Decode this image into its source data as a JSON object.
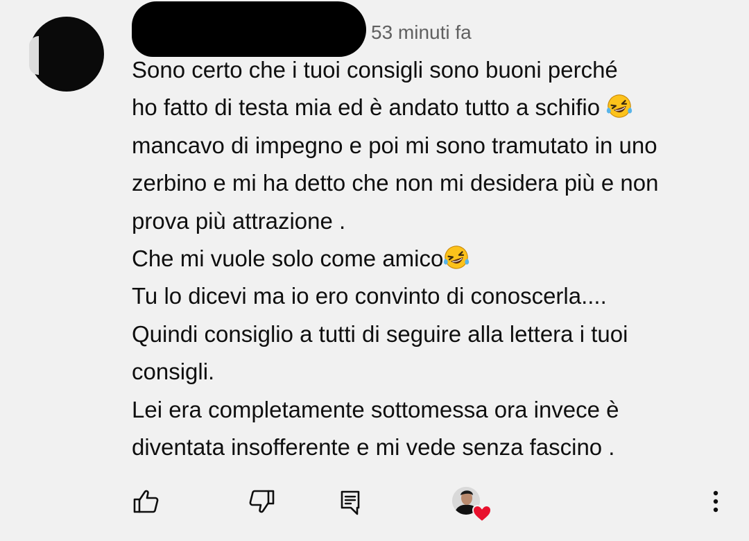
{
  "comment": {
    "timestamp": "53 minuti fa",
    "lines": [
      {
        "text": "Sono certo che i tuoi consigli sono buoni perché",
        "emoji": false
      },
      {
        "text": "ho fatto di testa mia ed è andato tutto a schifio ",
        "emoji": true
      },
      {
        "text": "mancavo di impegno e poi mi sono tramutato in uno",
        "emoji": false
      },
      {
        "text": "zerbino e mi ha detto che non mi desidera più e non",
        "emoji": false
      },
      {
        "text": "prova più attrazione .",
        "emoji": false
      },
      {
        "text": "Che mi vuole solo come amico",
        "emoji": true
      },
      {
        "text": "Tu lo dicevi ma io ero convinto di conoscerla....",
        "emoji": false
      },
      {
        "text": "Quindi consiglio a tutti di seguire alla lettera i tuoi",
        "emoji": false
      },
      {
        "text": "consigli.",
        "emoji": false
      },
      {
        "text": "Lei era completamente sottomessa ora invece è",
        "emoji": false
      },
      {
        "text": "diventata insofferente e mi vede  senza fascino .",
        "emoji": false
      }
    ],
    "emoji_icon": "rolling-on-floor-laughing-emoji"
  },
  "actions": {
    "like_icon": "thumbs-up-icon",
    "dislike_icon": "thumbs-down-icon",
    "reply_icon": "reply-comment-icon",
    "creator_heart_icon": "creator-heart-icon",
    "more_icon": "more-vert-icon"
  },
  "colors": {
    "background": "#f1f1f1",
    "text": "#0f0f0f",
    "secondary_text": "#606060",
    "heart": "#e8112d",
    "emoji_face": "#fcc21b"
  }
}
